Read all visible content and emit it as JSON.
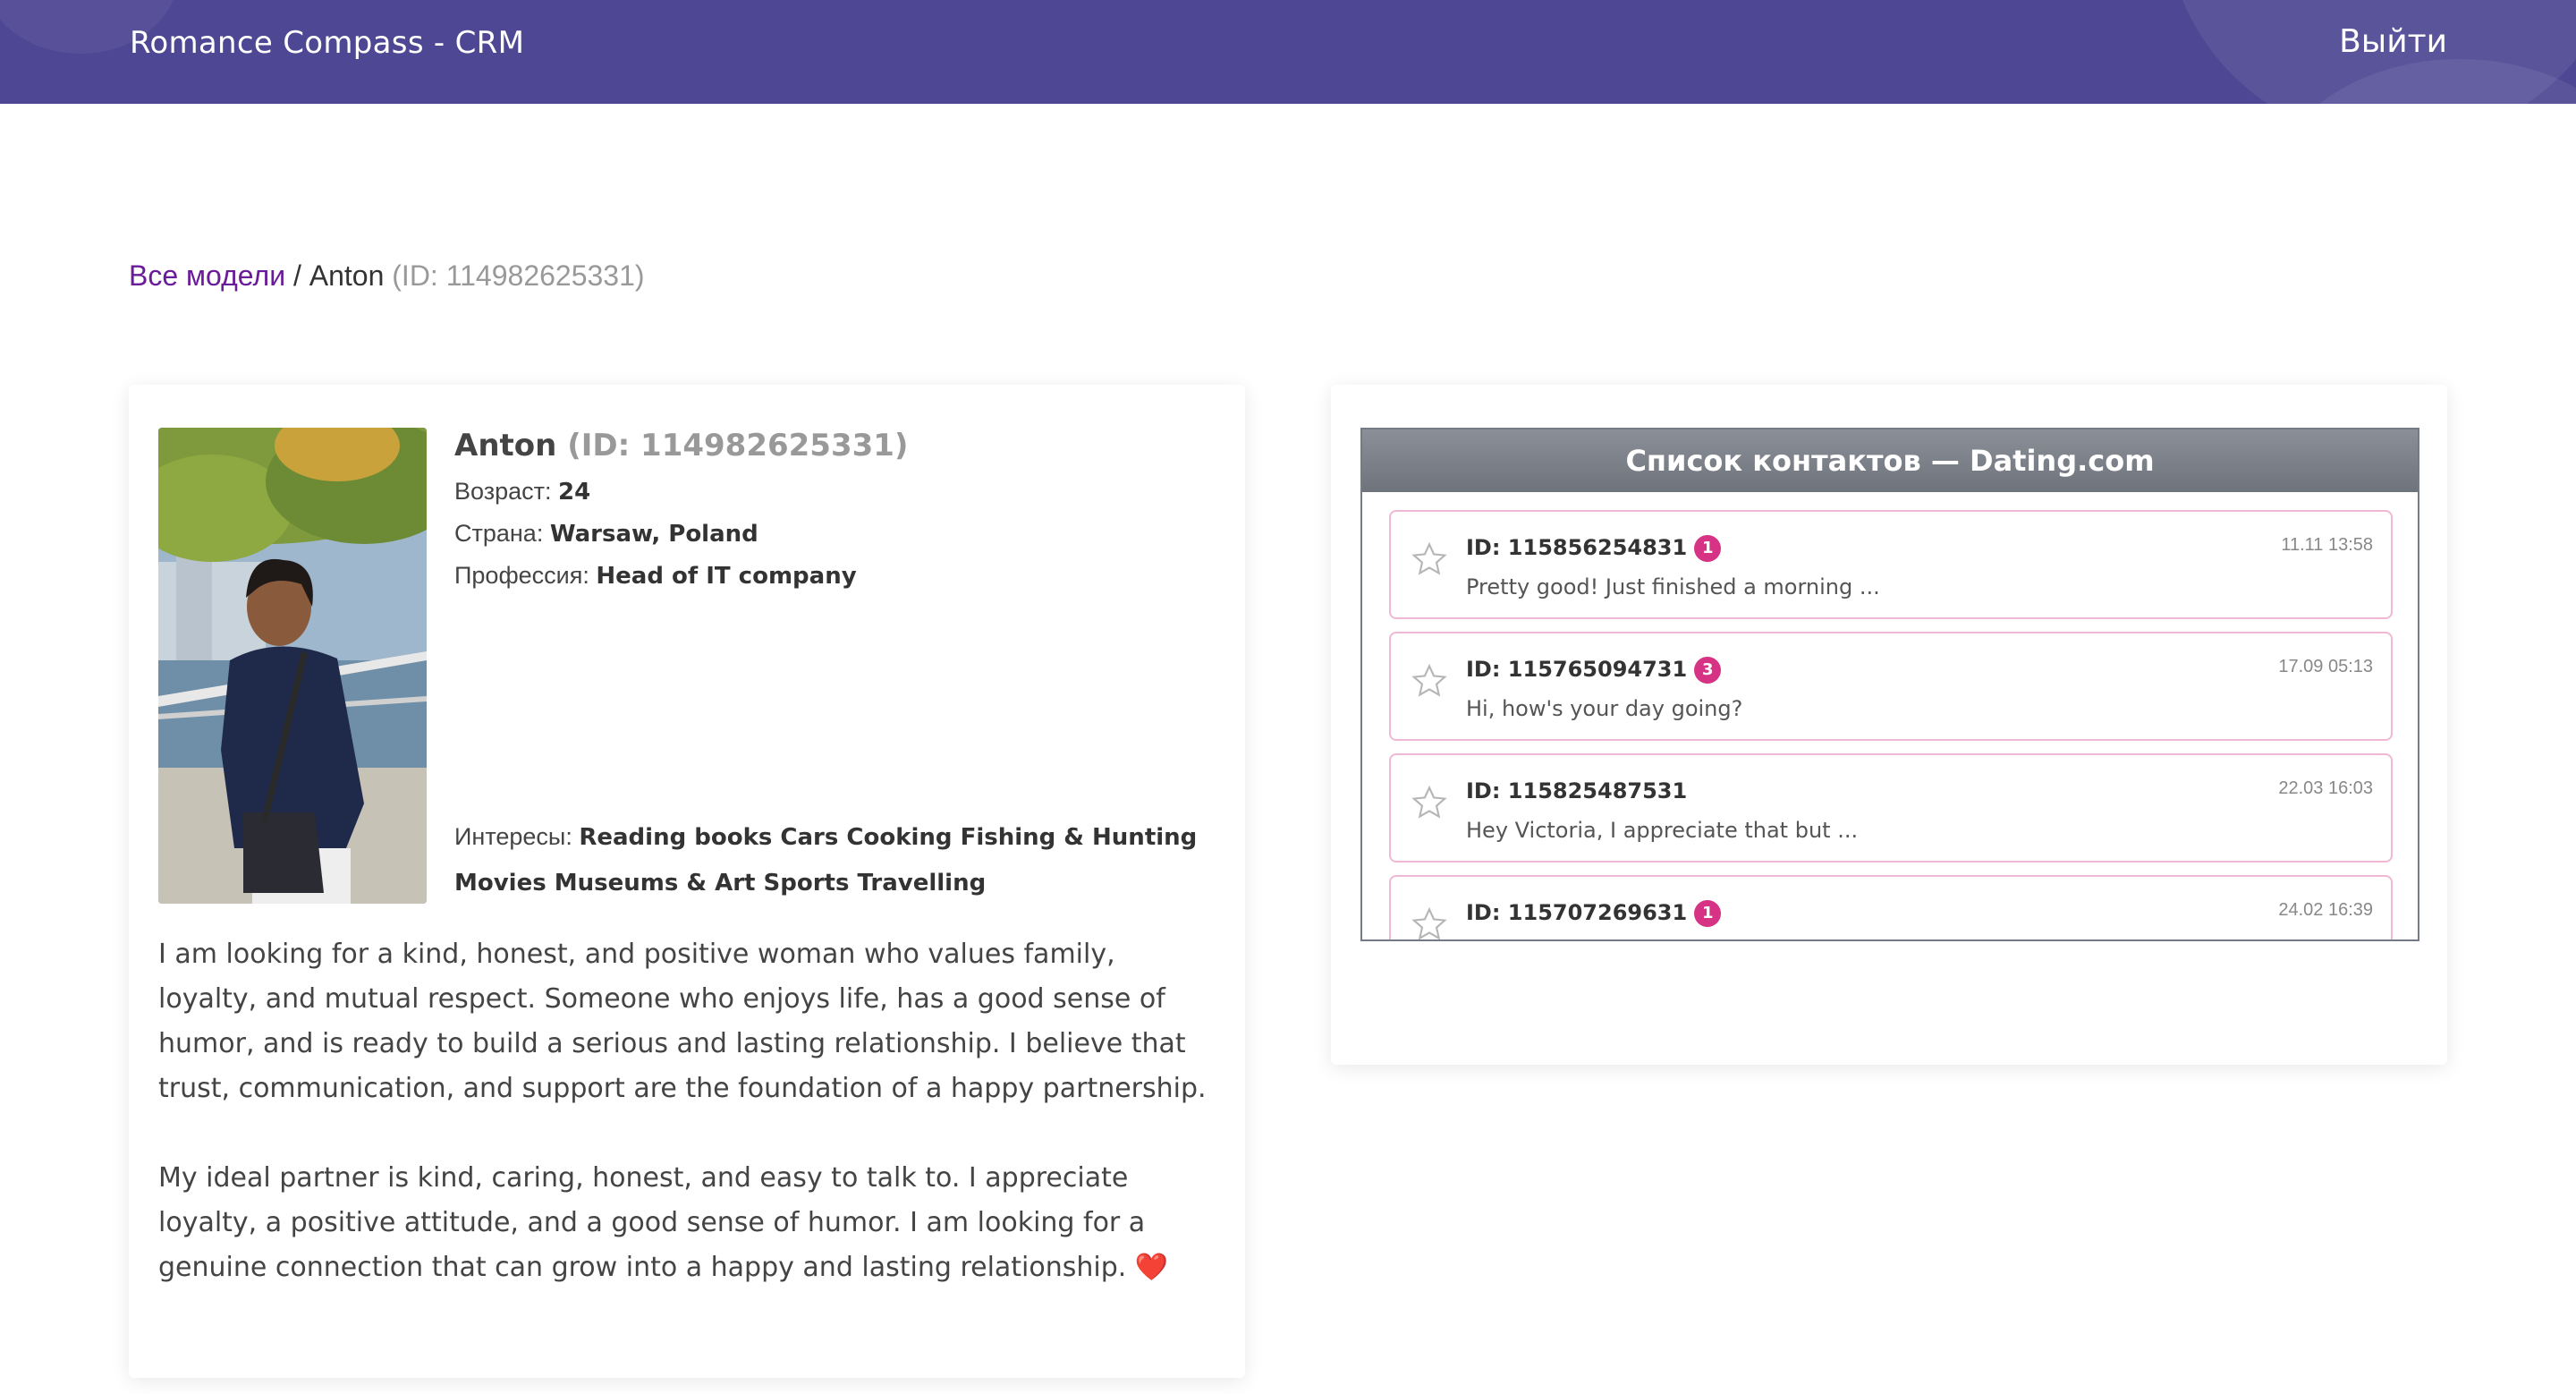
{
  "header": {
    "brand": "Romance Compass - CRM",
    "logout": "Выйти"
  },
  "breadcrumb": {
    "link": "Все модели",
    "sep": "/",
    "name": "Anton",
    "id": "(ID: 114982625331)"
  },
  "profile": {
    "name": "Anton",
    "id": "(ID: 114982625331)",
    "age_label": "Возраст:",
    "age": "24",
    "country_label": "Страна:",
    "country": "Warsaw, Poland",
    "profession_label": "Профессия:",
    "profession": "Head of IT company",
    "interests_label": "Интересы:",
    "interests": "Reading books Cars Cooking Fishing & Hunting Movies Museums & Art Sports Travelling",
    "bio_p1": "I am looking for a kind, honest, and positive woman who values family, loyalty, and mutual respect. Someone who enjoys life, has a good sense of humor, and is ready to build a serious and lasting relationship. I believe that trust, communication, and support are the foundation of a happy partnership.",
    "bio_p2": "My ideal partner is kind, caring, honest, and easy to talk to. I appreciate loyalty, a positive attitude, and a good sense of humor. I am looking for a genuine connection that can grow into a happy and lasting relationship.",
    "bio_emoji": "❤️"
  },
  "contacts": {
    "title": "Список контактов — Dating.com",
    "items": [
      {
        "id": "ID: 115856254831",
        "badge": "1",
        "message": "Pretty good! Just finished a morning ...",
        "time": "11.11 13:58"
      },
      {
        "id": "ID: 115765094731",
        "badge": "3",
        "message": "Hi, how's your day going?",
        "time": "17.09 05:13"
      },
      {
        "id": "ID: 115825487531",
        "badge": "",
        "message": "Hey Victoria, I appreciate that but ...",
        "time": "22.03 16:03"
      },
      {
        "id": "ID: 115707269631",
        "badge": "1",
        "message": "",
        "time": "24.02 16:39"
      }
    ]
  },
  "colors": {
    "header": "#4e4793",
    "link": "#6a1b9a",
    "badge": "#d63384",
    "item_border": "#f0b8d4"
  }
}
